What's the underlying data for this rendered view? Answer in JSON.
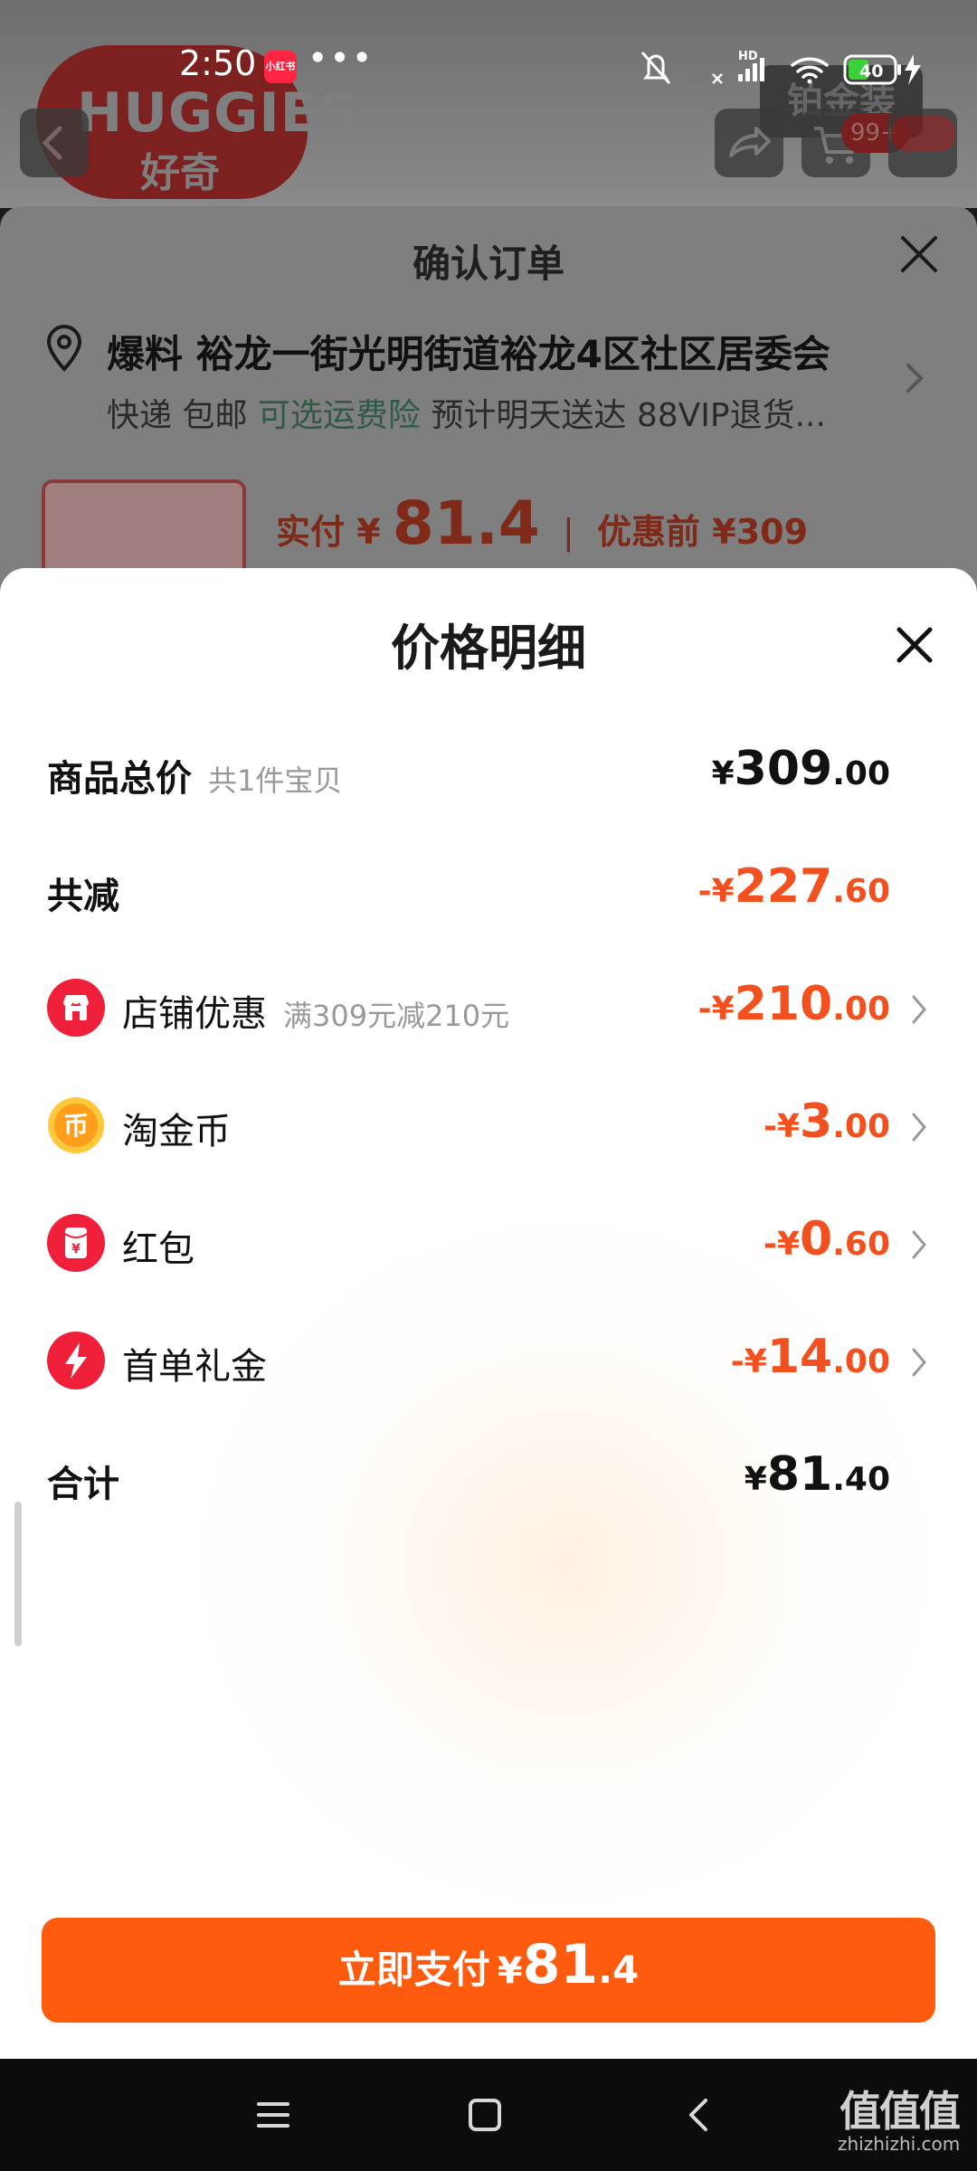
{
  "status_bar": {
    "time": "2:50",
    "app_badge": "小红书",
    "more": "•••",
    "battery": "40"
  },
  "background_page": {
    "brand_name": "HUGGIES",
    "brand_sub": "好奇",
    "top_right_tag": "铂金装",
    "cart_badge": "99+",
    "confirm_title": "确认订单",
    "address": "爆料 裕龙一街光明街道裕龙4区社区居委会",
    "delivery_prefix": "快递 包邮",
    "delivery_insurance": "可选运费险",
    "delivery_suffix": "预计明天送达 88VIP退货...",
    "price_paid_label": "实付 ¥",
    "price_paid_value": "81.4",
    "price_before": "优惠前 ¥309"
  },
  "price_detail": {
    "title": "价格明细",
    "rows": [
      {
        "label": "商品总价",
        "hint": "共1件宝贝",
        "currency": "¥",
        "int": "309",
        "dec": ".00"
      },
      {
        "label": "共减",
        "currency": "-¥",
        "int": "227",
        "dec": ".60"
      },
      {
        "label": "店铺优惠",
        "hint": "满309元减210元",
        "currency": "-¥",
        "int": "210",
        "dec": ".00",
        "icon": "store-icon"
      },
      {
        "label": "淘金币",
        "currency": "-¥",
        "int": "3",
        "dec": ".00",
        "icon": "coin-icon"
      },
      {
        "label": "红包",
        "currency": "-¥",
        "int": "0",
        "dec": ".60",
        "icon": "red-envelope-icon"
      },
      {
        "label": "首单礼金",
        "currency": "-¥",
        "int": "14",
        "dec": ".00",
        "icon": "lightning-icon"
      },
      {
        "label": "合计",
        "currency": "¥",
        "int": "81",
        "dec": ".40"
      }
    ],
    "pay_button": {
      "label": "立即支付",
      "currency": "¥",
      "int": "81",
      "dec": ".4"
    }
  },
  "watermark": {
    "main": "值值值",
    "sub": "zhizhizhi.com"
  },
  "colors": {
    "accent_orange": "#f2501e",
    "pay_button": "#ff5b0e",
    "insurance_green": "#2f5a45"
  }
}
